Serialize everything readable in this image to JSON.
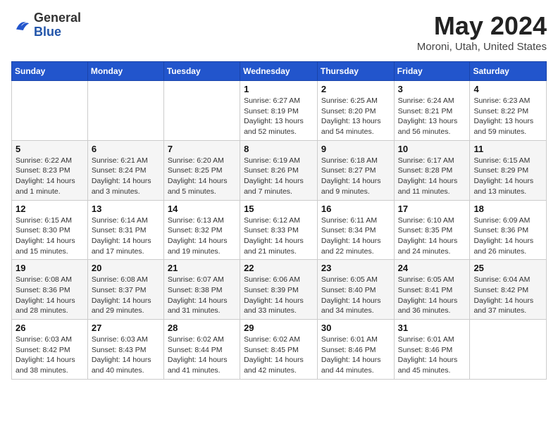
{
  "header": {
    "logo_line1": "General",
    "logo_line2": "Blue",
    "title": "May 2024",
    "location": "Moroni, Utah, United States"
  },
  "weekdays": [
    "Sunday",
    "Monday",
    "Tuesday",
    "Wednesday",
    "Thursday",
    "Friday",
    "Saturday"
  ],
  "weeks": [
    [
      {
        "day": "",
        "sunrise": "",
        "sunset": "",
        "daylight": ""
      },
      {
        "day": "",
        "sunrise": "",
        "sunset": "",
        "daylight": ""
      },
      {
        "day": "",
        "sunrise": "",
        "sunset": "",
        "daylight": ""
      },
      {
        "day": "1",
        "sunrise": "Sunrise: 6:27 AM",
        "sunset": "Sunset: 8:19 PM",
        "daylight": "Daylight: 13 hours and 52 minutes."
      },
      {
        "day": "2",
        "sunrise": "Sunrise: 6:25 AM",
        "sunset": "Sunset: 8:20 PM",
        "daylight": "Daylight: 13 hours and 54 minutes."
      },
      {
        "day": "3",
        "sunrise": "Sunrise: 6:24 AM",
        "sunset": "Sunset: 8:21 PM",
        "daylight": "Daylight: 13 hours and 56 minutes."
      },
      {
        "day": "4",
        "sunrise": "Sunrise: 6:23 AM",
        "sunset": "Sunset: 8:22 PM",
        "daylight": "Daylight: 13 hours and 59 minutes."
      }
    ],
    [
      {
        "day": "5",
        "sunrise": "Sunrise: 6:22 AM",
        "sunset": "Sunset: 8:23 PM",
        "daylight": "Daylight: 14 hours and 1 minute."
      },
      {
        "day": "6",
        "sunrise": "Sunrise: 6:21 AM",
        "sunset": "Sunset: 8:24 PM",
        "daylight": "Daylight: 14 hours and 3 minutes."
      },
      {
        "day": "7",
        "sunrise": "Sunrise: 6:20 AM",
        "sunset": "Sunset: 8:25 PM",
        "daylight": "Daylight: 14 hours and 5 minutes."
      },
      {
        "day": "8",
        "sunrise": "Sunrise: 6:19 AM",
        "sunset": "Sunset: 8:26 PM",
        "daylight": "Daylight: 14 hours and 7 minutes."
      },
      {
        "day": "9",
        "sunrise": "Sunrise: 6:18 AM",
        "sunset": "Sunset: 8:27 PM",
        "daylight": "Daylight: 14 hours and 9 minutes."
      },
      {
        "day": "10",
        "sunrise": "Sunrise: 6:17 AM",
        "sunset": "Sunset: 8:28 PM",
        "daylight": "Daylight: 14 hours and 11 minutes."
      },
      {
        "day": "11",
        "sunrise": "Sunrise: 6:15 AM",
        "sunset": "Sunset: 8:29 PM",
        "daylight": "Daylight: 14 hours and 13 minutes."
      }
    ],
    [
      {
        "day": "12",
        "sunrise": "Sunrise: 6:15 AM",
        "sunset": "Sunset: 8:30 PM",
        "daylight": "Daylight: 14 hours and 15 minutes."
      },
      {
        "day": "13",
        "sunrise": "Sunrise: 6:14 AM",
        "sunset": "Sunset: 8:31 PM",
        "daylight": "Daylight: 14 hours and 17 minutes."
      },
      {
        "day": "14",
        "sunrise": "Sunrise: 6:13 AM",
        "sunset": "Sunset: 8:32 PM",
        "daylight": "Daylight: 14 hours and 19 minutes."
      },
      {
        "day": "15",
        "sunrise": "Sunrise: 6:12 AM",
        "sunset": "Sunset: 8:33 PM",
        "daylight": "Daylight: 14 hours and 21 minutes."
      },
      {
        "day": "16",
        "sunrise": "Sunrise: 6:11 AM",
        "sunset": "Sunset: 8:34 PM",
        "daylight": "Daylight: 14 hours and 22 minutes."
      },
      {
        "day": "17",
        "sunrise": "Sunrise: 6:10 AM",
        "sunset": "Sunset: 8:35 PM",
        "daylight": "Daylight: 14 hours and 24 minutes."
      },
      {
        "day": "18",
        "sunrise": "Sunrise: 6:09 AM",
        "sunset": "Sunset: 8:36 PM",
        "daylight": "Daylight: 14 hours and 26 minutes."
      }
    ],
    [
      {
        "day": "19",
        "sunrise": "Sunrise: 6:08 AM",
        "sunset": "Sunset: 8:36 PM",
        "daylight": "Daylight: 14 hours and 28 minutes."
      },
      {
        "day": "20",
        "sunrise": "Sunrise: 6:08 AM",
        "sunset": "Sunset: 8:37 PM",
        "daylight": "Daylight: 14 hours and 29 minutes."
      },
      {
        "day": "21",
        "sunrise": "Sunrise: 6:07 AM",
        "sunset": "Sunset: 8:38 PM",
        "daylight": "Daylight: 14 hours and 31 minutes."
      },
      {
        "day": "22",
        "sunrise": "Sunrise: 6:06 AM",
        "sunset": "Sunset: 8:39 PM",
        "daylight": "Daylight: 14 hours and 33 minutes."
      },
      {
        "day": "23",
        "sunrise": "Sunrise: 6:05 AM",
        "sunset": "Sunset: 8:40 PM",
        "daylight": "Daylight: 14 hours and 34 minutes."
      },
      {
        "day": "24",
        "sunrise": "Sunrise: 6:05 AM",
        "sunset": "Sunset: 8:41 PM",
        "daylight": "Daylight: 14 hours and 36 minutes."
      },
      {
        "day": "25",
        "sunrise": "Sunrise: 6:04 AM",
        "sunset": "Sunset: 8:42 PM",
        "daylight": "Daylight: 14 hours and 37 minutes."
      }
    ],
    [
      {
        "day": "26",
        "sunrise": "Sunrise: 6:03 AM",
        "sunset": "Sunset: 8:42 PM",
        "daylight": "Daylight: 14 hours and 38 minutes."
      },
      {
        "day": "27",
        "sunrise": "Sunrise: 6:03 AM",
        "sunset": "Sunset: 8:43 PM",
        "daylight": "Daylight: 14 hours and 40 minutes."
      },
      {
        "day": "28",
        "sunrise": "Sunrise: 6:02 AM",
        "sunset": "Sunset: 8:44 PM",
        "daylight": "Daylight: 14 hours and 41 minutes."
      },
      {
        "day": "29",
        "sunrise": "Sunrise: 6:02 AM",
        "sunset": "Sunset: 8:45 PM",
        "daylight": "Daylight: 14 hours and 42 minutes."
      },
      {
        "day": "30",
        "sunrise": "Sunrise: 6:01 AM",
        "sunset": "Sunset: 8:46 PM",
        "daylight": "Daylight: 14 hours and 44 minutes."
      },
      {
        "day": "31",
        "sunrise": "Sunrise: 6:01 AM",
        "sunset": "Sunset: 8:46 PM",
        "daylight": "Daylight: 14 hours and 45 minutes."
      },
      {
        "day": "",
        "sunrise": "",
        "sunset": "",
        "daylight": ""
      }
    ]
  ]
}
